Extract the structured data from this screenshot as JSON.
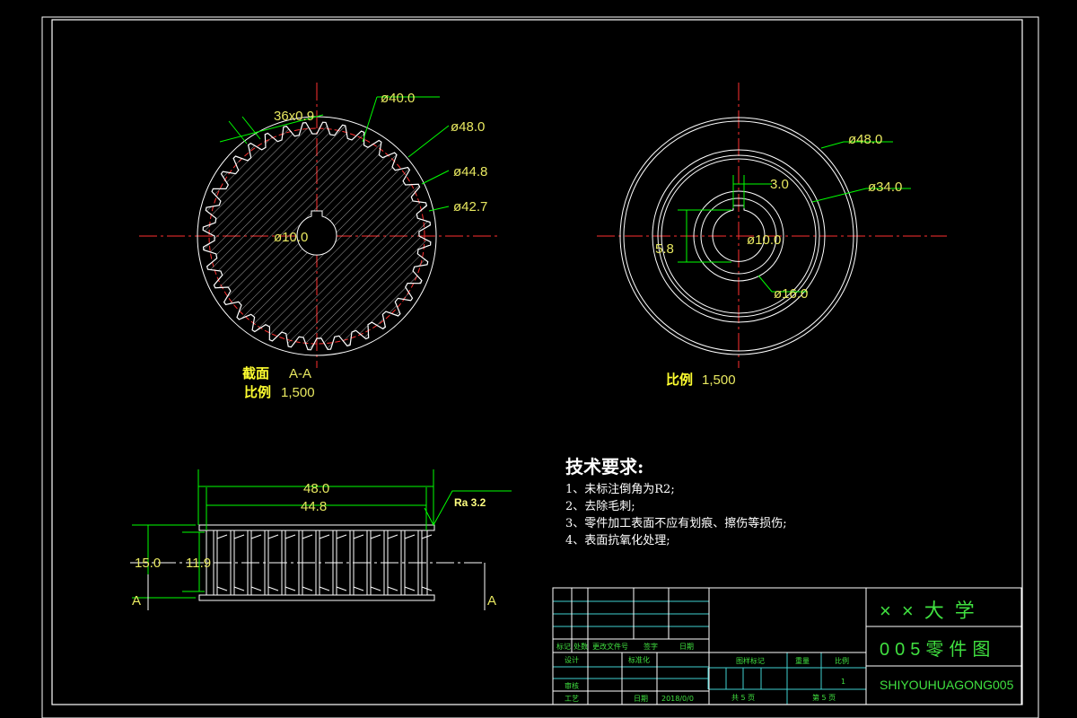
{
  "colors": {
    "background": "#000000",
    "outline": "#ffffff",
    "dimension": "#00ff00",
    "text": "#ffff66",
    "centerline": "#ff3030",
    "tableline": "#40d0d0"
  },
  "section_view": {
    "dims": {
      "chamfer": "36x0.9",
      "d40": "ø40.0",
      "d48": "ø48.0",
      "d448": "ø44.8",
      "d427": "ø42.7",
      "bore": "ø10.0"
    },
    "label": "截面",
    "section": "A-A",
    "scale_label": "比例",
    "scale": "1,500"
  },
  "front_view": {
    "dims": {
      "d48": "ø48.0",
      "d34": "ø34.0",
      "key": "3.0",
      "keydepth": "5.8",
      "bore": "ø10.0",
      "d16": "ø16.0"
    },
    "scale_label": "比例",
    "scale": "1,500"
  },
  "side_view": {
    "dims": {
      "w48": "48.0",
      "w448": "44.8",
      "h15": "15.0",
      "h119": "11.9"
    },
    "roughness": "Ra 3.2",
    "section_mark": "A"
  },
  "requirements": {
    "title": "技术要求:",
    "items": [
      "1、未标注倒角为R2;",
      "2、去除毛刺;",
      "3、零件加工表面不应有划痕、擦伤等损伤;",
      "4、表面抗氧化处理;"
    ]
  },
  "title_block": {
    "school": "××大学",
    "drawing_name": "005零件图",
    "code": "SHIYOUHUAGONG005",
    "headers": [
      "标记",
      "处数",
      "更改文件号",
      "签字",
      "日期"
    ],
    "design": "设计",
    "standard": "标准化",
    "review": "审核",
    "process": "工艺",
    "date": "日期",
    "date_value": "2018/0/0",
    "drawing_mark": "图样标记",
    "weight": "重量",
    "scale": "比例",
    "scale_value": "1",
    "total_sheets": "共 5 页",
    "sheet": "第 5 页"
  }
}
